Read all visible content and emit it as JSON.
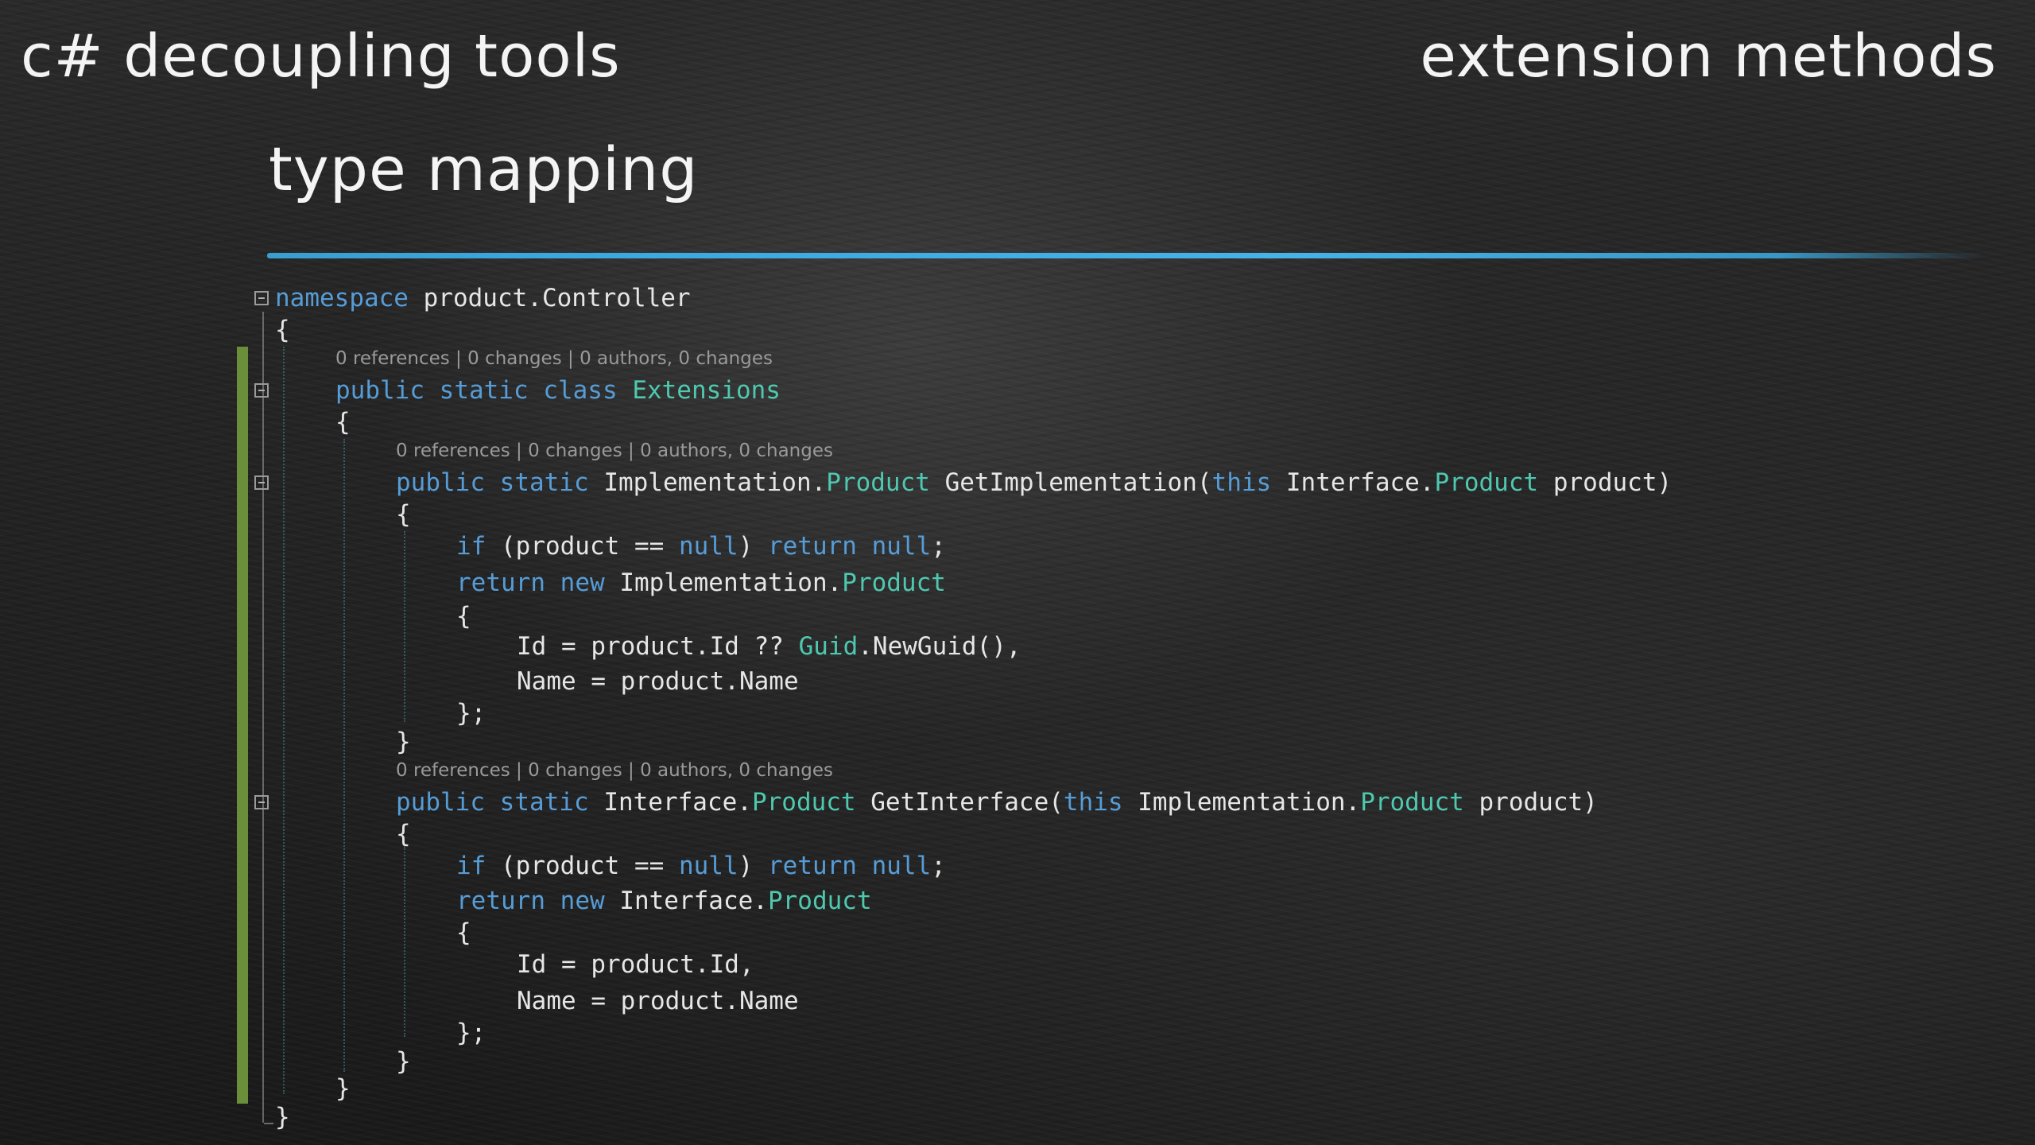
{
  "slide": {
    "title_left": "c# decoupling tools",
    "title_right": "extension methods",
    "subtitle": "type mapping"
  },
  "code": {
    "lens1": "0 references | 0 changes | 0 authors, 0 changes",
    "lens2": "0 references | 0 changes | 0 authors, 0 changes",
    "lens3": "0 references | 0 changes | 0 authors, 0 changes",
    "kw_namespace": "namespace",
    "ns_name": " product.Controller",
    "brace_open": "{",
    "brace_close": "}",
    "kw_public": "public",
    "kw_static": "static",
    "kw_class": "class",
    "class_name": "Extensions",
    "m1_ret_prefix": "Implementation.",
    "ty_product": "Product",
    "m1_name": " GetImplementation(",
    "kw_this": "this",
    "m1_param_prefix": " Interface.",
    "param_tail": " product)",
    "kw_if": "if",
    "if_mid": " (product == ",
    "kw_null": "null",
    "close_paren": ") ",
    "kw_return": "return",
    "semicolon": ";",
    "kw_new": "new",
    "impl_prefix": " Implementation.",
    "m1_id_prefix": "Id = product.Id ?? ",
    "ty_guid": "Guid",
    "m1_id_suffix": ".NewGuid(),",
    "name_line": "Name = product.Name",
    "end_init": "};",
    "m2_ret_prefix": "Interface.",
    "m2_name": " GetInterface(",
    "m2_param_prefix": " Implementation.",
    "iface_prefix": " Interface.",
    "m2_id_line": "Id = product.Id,"
  }
}
